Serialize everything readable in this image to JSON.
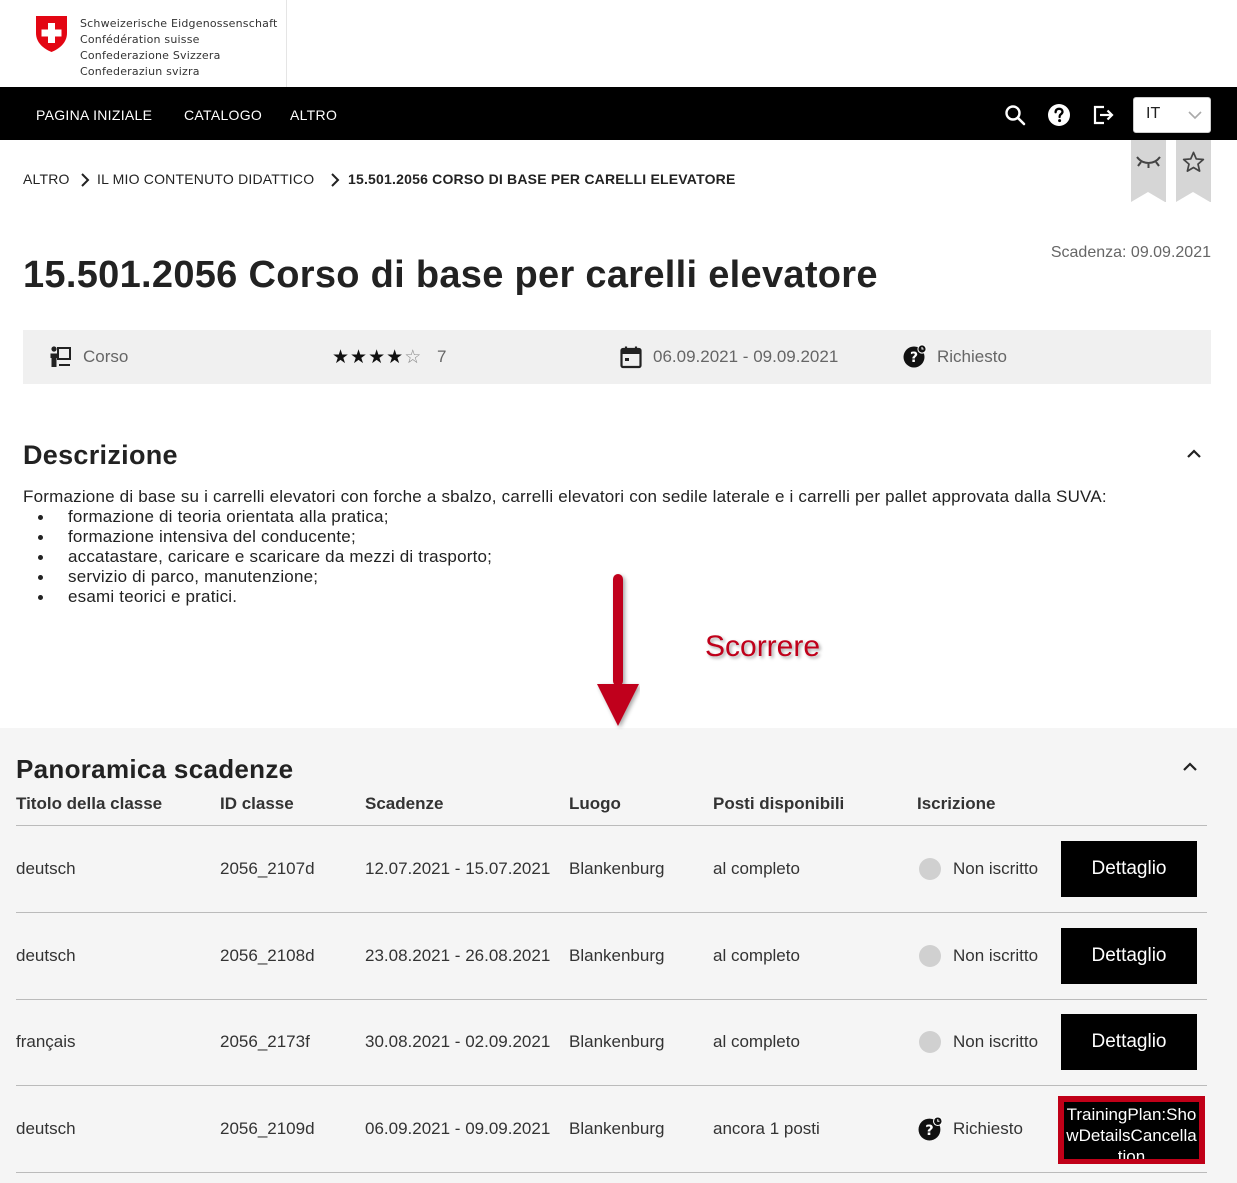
{
  "header": {
    "brand_lines": [
      "Schweizerische Eidgenossenschaft",
      "Confédération suisse",
      "Confederazione Svizzera",
      "Confederaziun svizra"
    ],
    "nav": [
      "PAGINA INIZIALE",
      "CATALOGO",
      "ALTRO"
    ],
    "language": "IT"
  },
  "breadcrumb": [
    "ALTRO",
    "IL MIO CONTENUTO DIDATTICO",
    "15.501.2056 CORSO DI BASE PER CARELLI ELEVATORE"
  ],
  "course": {
    "deadline": "Scadenza: 09.09.2021",
    "title": "15.501.2056 Corso di base per carelli elevatore",
    "type": "Corso",
    "rating": 4,
    "rating_max": 5,
    "rating_count": "7",
    "dates": "06.09.2021 - 09.09.2021",
    "status": "Richiesto"
  },
  "description": {
    "heading": "Descrizione",
    "intro": "Formazione di base su i carrelli elevatori con forche a sbalzo, carrelli elevatori con sedile laterale e i carrelli per pallet approvata dalla SUVA:",
    "items": [
      "formazione di teoria orientata alla pratica;",
      "formazione intensiva del conducente;",
      "accatastare, caricare e scaricare da mezzi di trasporto;",
      "servizio di parco, manutenzione;",
      "esami teorici e pratici."
    ]
  },
  "annotation": {
    "scroll_label": "Scorrere",
    "arrow_color": "#c0001a"
  },
  "schedule": {
    "heading": "Panoramica scadenze",
    "columns": [
      "Titolo della classe",
      "ID classe",
      "Scadenze",
      "Luogo",
      "Posti disponibili",
      "Iscrizione"
    ],
    "rows": [
      {
        "title": "deutsch",
        "id": "2056_2107d",
        "dates": "12.07.2021 - 15.07.2021",
        "place": "Blankenburg",
        "seats": "al completo",
        "enrollment": "Non iscritto",
        "action": "Dettaglio"
      },
      {
        "title": "deutsch",
        "id": "2056_2108d",
        "dates": "23.08.2021 - 26.08.2021",
        "place": "Blankenburg",
        "seats": "al completo",
        "enrollment": "Non iscritto",
        "action": "Dettaglio"
      },
      {
        "title": "français",
        "id": "2056_2173f",
        "dates": "30.08.2021 - 02.09.2021",
        "place": "Blankenburg",
        "seats": "al completo",
        "enrollment": "Non iscritto",
        "action": "Dettaglio"
      },
      {
        "title": "deutsch",
        "id": "2056_2109d",
        "dates": "06.09.2021 - 09.09.2021",
        "place": "Blankenburg",
        "seats": "ancora 1 posti",
        "enrollment": "Richiesto",
        "action": "TrainingPlan:ShowDetailsCancellation"
      }
    ]
  }
}
